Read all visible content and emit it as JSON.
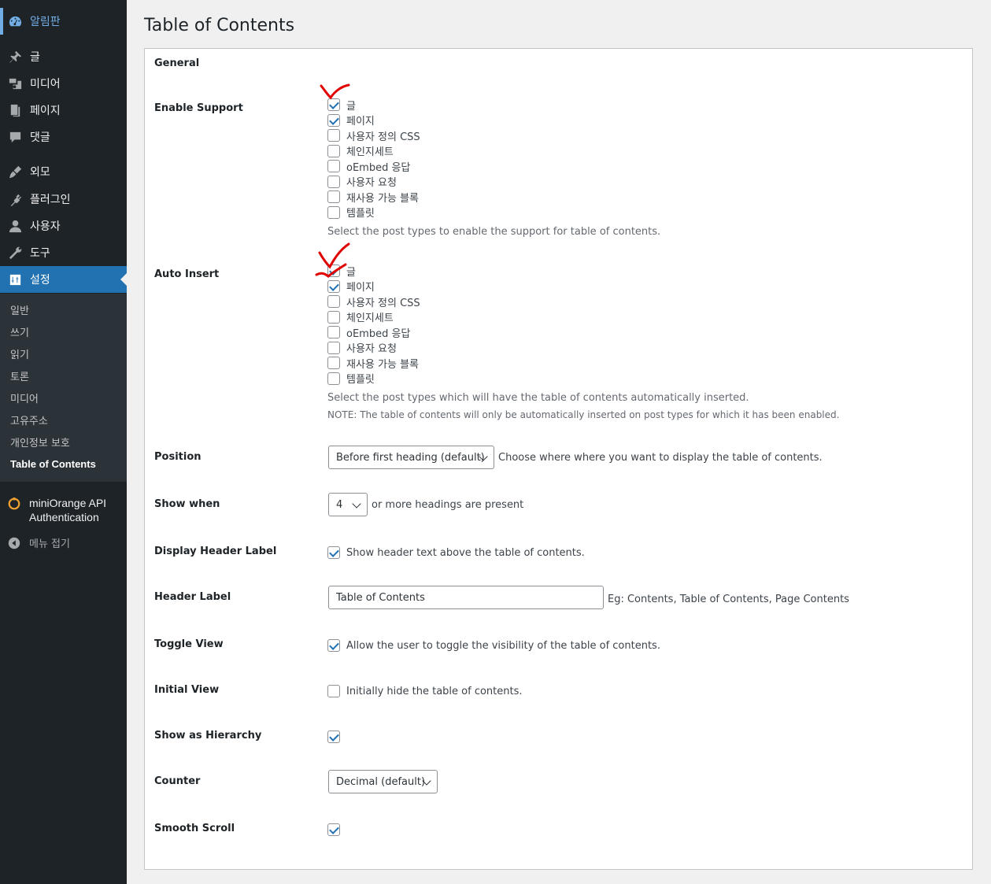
{
  "sidebar": {
    "items": [
      {
        "label": "알림판",
        "icon": "dashboard-icon"
      },
      {
        "label": "글",
        "icon": "pin-icon"
      },
      {
        "label": "미디어",
        "icon": "media-icon"
      },
      {
        "label": "페이지",
        "icon": "page-icon"
      },
      {
        "label": "댓글",
        "icon": "comment-icon"
      },
      {
        "label": "외모",
        "icon": "appearance-icon"
      },
      {
        "label": "플러그인",
        "icon": "plugin-icon"
      },
      {
        "label": "사용자",
        "icon": "users-icon"
      },
      {
        "label": "도구",
        "icon": "tools-icon"
      },
      {
        "label": "설정",
        "icon": "settings-icon"
      }
    ],
    "submenu": [
      "일반",
      "쓰기",
      "읽기",
      "토론",
      "미디어",
      "고유주소",
      "개인정보 보호",
      "Table of Contents"
    ],
    "miniorange_line1": "miniOrange API",
    "miniorange_line2": "Authentication",
    "collapse_label": "메뉴 접기"
  },
  "page": {
    "title": "Table of Contents",
    "section_general": "General"
  },
  "settings": {
    "enable_support": {
      "label": "Enable Support",
      "options": [
        {
          "label": "글",
          "checked": true
        },
        {
          "label": "페이지",
          "checked": true
        },
        {
          "label": "사용자 정의 CSS",
          "checked": false
        },
        {
          "label": "체인지세트",
          "checked": false
        },
        {
          "label": "oEmbed 응답",
          "checked": false
        },
        {
          "label": "사용자 요청",
          "checked": false
        },
        {
          "label": "재사용 가능 블록",
          "checked": false
        },
        {
          "label": "템플릿",
          "checked": false
        }
      ],
      "description": "Select the post types to enable the support for table of contents."
    },
    "auto_insert": {
      "label": "Auto Insert",
      "options": [
        {
          "label": "글",
          "checked": true
        },
        {
          "label": "페이지",
          "checked": true
        },
        {
          "label": "사용자 정의 CSS",
          "checked": false
        },
        {
          "label": "체인지세트",
          "checked": false
        },
        {
          "label": "oEmbed 응답",
          "checked": false
        },
        {
          "label": "사용자 요청",
          "checked": false
        },
        {
          "label": "재사용 가능 블록",
          "checked": false
        },
        {
          "label": "템플릿",
          "checked": false
        }
      ],
      "description": "Select the post types which will have the table of contents automatically inserted.",
      "note": "NOTE: The table of contents will only be automatically inserted on post types for which it has been enabled."
    },
    "position": {
      "label": "Position",
      "value": "Before first heading (default)",
      "help": "Choose where where you want to display the table of contents."
    },
    "show_when": {
      "label": "Show when",
      "value": "4",
      "help": "or more headings are present"
    },
    "display_header_label": {
      "label": "Display Header Label",
      "checked": true,
      "text": "Show header text above the table of contents."
    },
    "header_label": {
      "label": "Header Label",
      "value": "Table of Contents",
      "help": "Eg: Contents, Table of Contents, Page Contents"
    },
    "toggle_view": {
      "label": "Toggle View",
      "checked": true,
      "text": "Allow the user to toggle the visibility of the table of contents."
    },
    "initial_view": {
      "label": "Initial View",
      "checked": false,
      "text": "Initially hide the table of contents."
    },
    "show_as_hierarchy": {
      "label": "Show as Hierarchy",
      "checked": true
    },
    "counter": {
      "label": "Counter",
      "value": "Decimal (default)"
    },
    "smooth_scroll": {
      "label": "Smooth Scroll",
      "checked": true
    }
  },
  "colors": {
    "sidebar_bg": "#1d2327",
    "active_blue": "#2271b1",
    "annotation_red": "#e00000"
  }
}
